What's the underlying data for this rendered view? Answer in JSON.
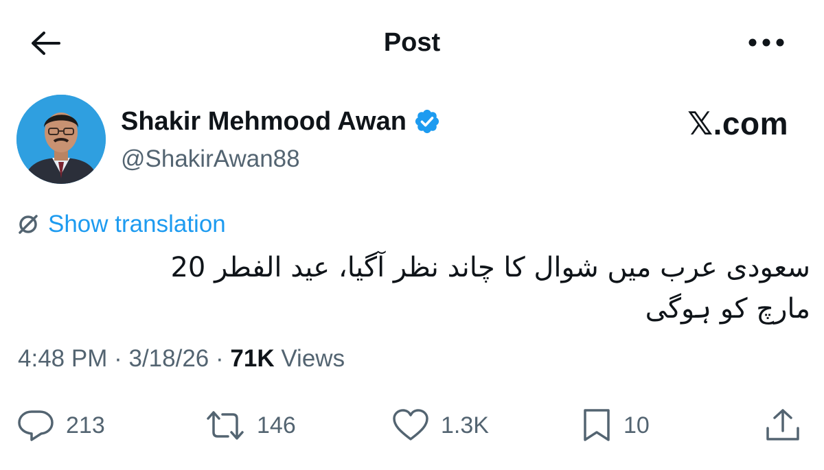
{
  "header": {
    "title": "Post"
  },
  "author": {
    "name": "Shakir Mehmood Awan",
    "handle": "@ShakirAwan88"
  },
  "brand": {
    "text": "𝕏.com"
  },
  "translation": {
    "label": "Show translation"
  },
  "tweet": {
    "text": "سعودی عرب میں شوال کا چاند نظر آگیا، عید الفطر 20 مارچ کو ہوگی"
  },
  "meta": {
    "time": "4:48 PM",
    "date": "3/18/26",
    "views_count": "71K",
    "views_label": "Views",
    "separator": "·"
  },
  "actions": {
    "replies": "213",
    "reposts": "146",
    "likes": "1.3K",
    "bookmarks": "10"
  },
  "colors": {
    "accent": "#1d9bf0",
    "secondary_text": "#536471",
    "primary_text": "#0f1419"
  },
  "icons": [
    "back-arrow-icon",
    "more-dots-icon",
    "verified-badge-icon",
    "translate-icon",
    "reply-icon",
    "repost-icon",
    "like-icon",
    "bookmark-icon",
    "share-icon"
  ]
}
